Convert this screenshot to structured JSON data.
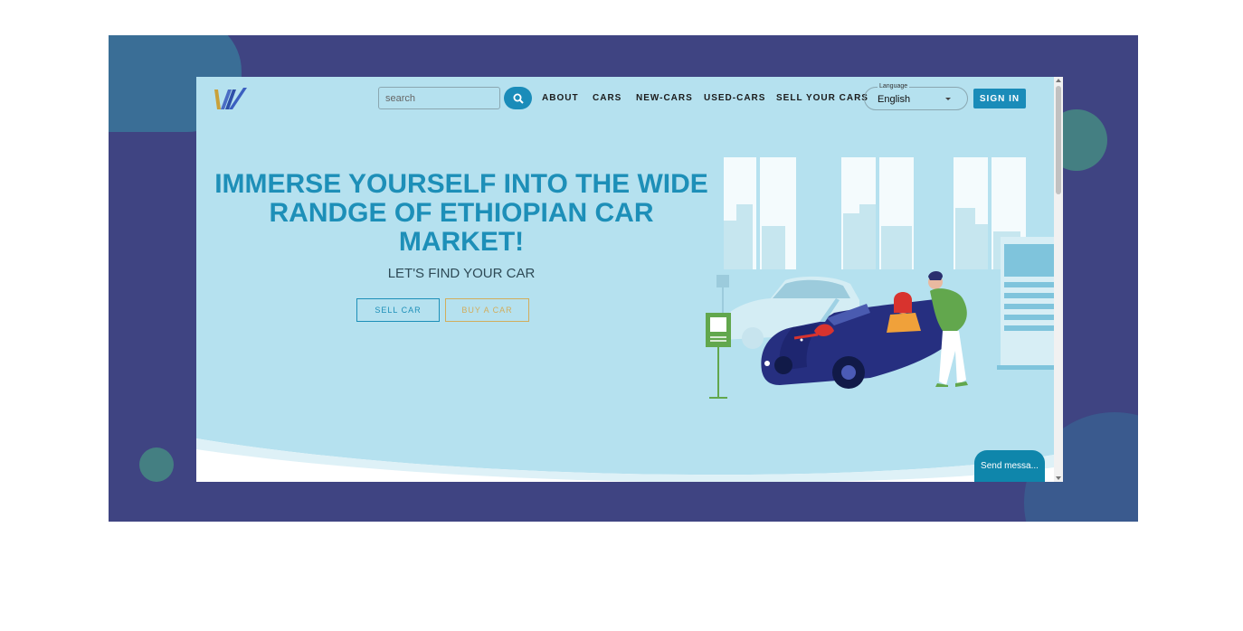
{
  "header": {
    "search": {
      "placeholder": "search"
    },
    "nav": [
      {
        "label": "ABOUT"
      },
      {
        "label": "CARS"
      },
      {
        "label": "NEW-CARS"
      },
      {
        "label": "USED-CARS"
      },
      {
        "label": "SELL YOUR CARS"
      }
    ],
    "language": {
      "label": "Language",
      "value": "English"
    },
    "signin_label": "SIGN IN"
  },
  "hero": {
    "title": "IMMERSE YOURSELF INTO THE WIDE RANDGE OF ETHIOPIAN CAR MARKET!",
    "subtitle": "LET'S FIND YOUR CAR",
    "sell_label": "SELL CAR",
    "buy_label": "BUY A CAR"
  },
  "chat": {
    "label": "Send messa..."
  },
  "colors": {
    "frame": "#3f4482",
    "page_bg": "#b5e1ef",
    "accent": "#1a8cb9",
    "title": "#1d8fb8",
    "buy_outline": "#d2ad5c"
  },
  "icons": [
    "logo-icon",
    "search-icon",
    "chevron-down-icon"
  ]
}
